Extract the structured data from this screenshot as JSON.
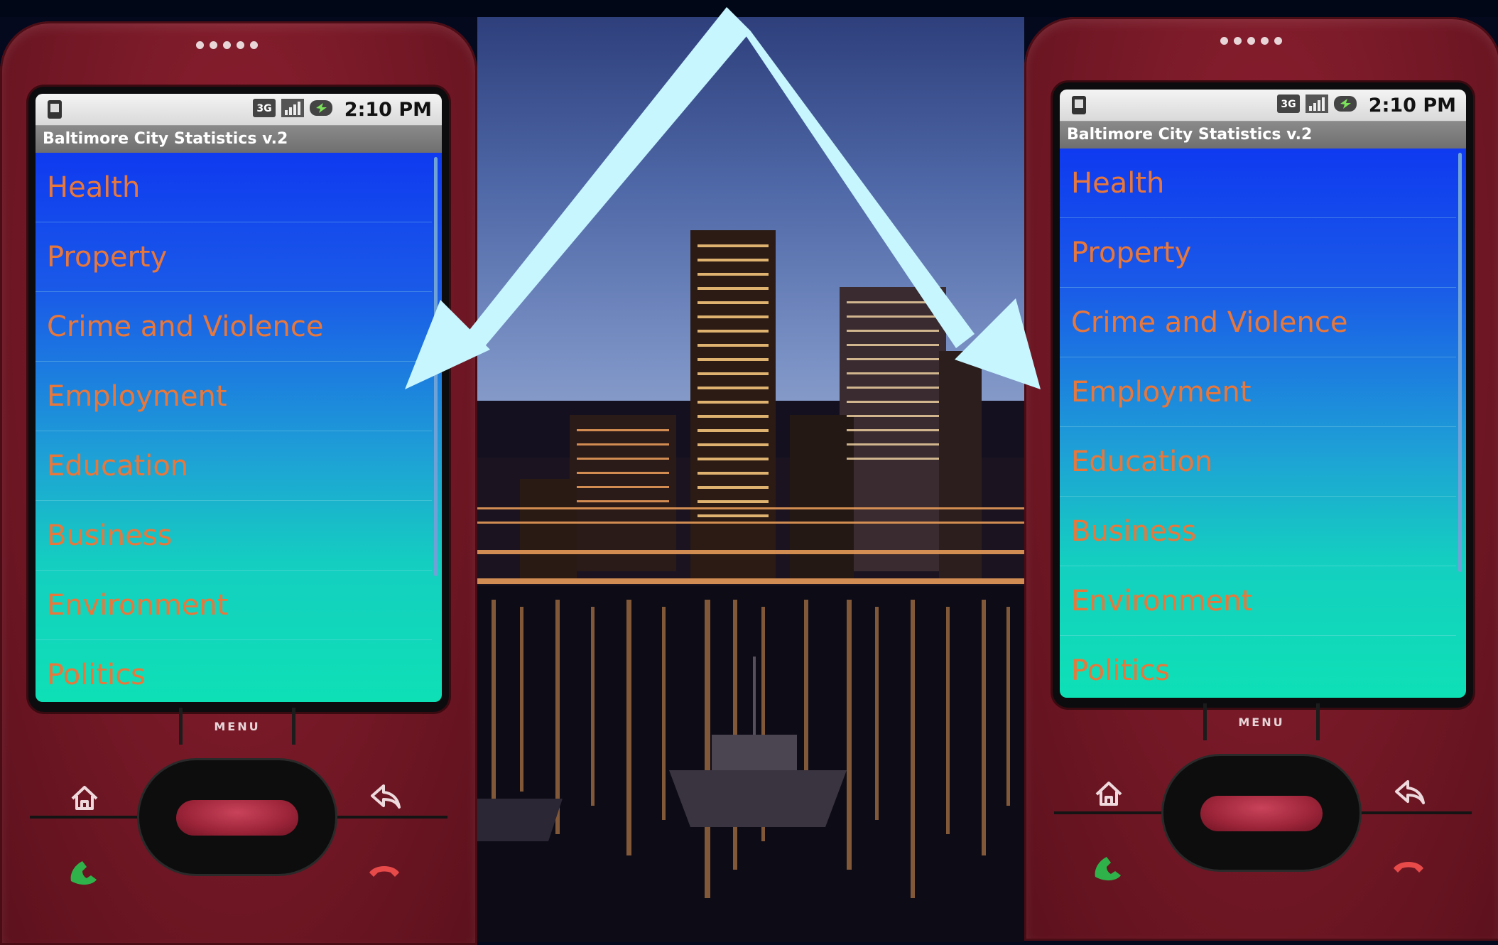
{
  "status": {
    "network": "3G",
    "time": "2:10 PM"
  },
  "app": {
    "title": "Baltimore City Statistics v.2"
  },
  "menu_items": [
    "Health",
    "Property",
    "Crime and Violence",
    "Employment",
    "Education",
    "Business",
    "Environment",
    "Politics"
  ],
  "hardware": {
    "menu_label": "MENU"
  },
  "colors": {
    "phone_body": "#741826",
    "list_top": "#0f3af0",
    "list_bottom": "#0ee0b6",
    "item_text": "#e8773b",
    "arrow": "#c8f6ff"
  },
  "icons": [
    "sim-icon",
    "network-3g-icon",
    "signal-icon",
    "battery-icon",
    "home-icon",
    "back-icon",
    "call-icon",
    "end-call-icon"
  ]
}
